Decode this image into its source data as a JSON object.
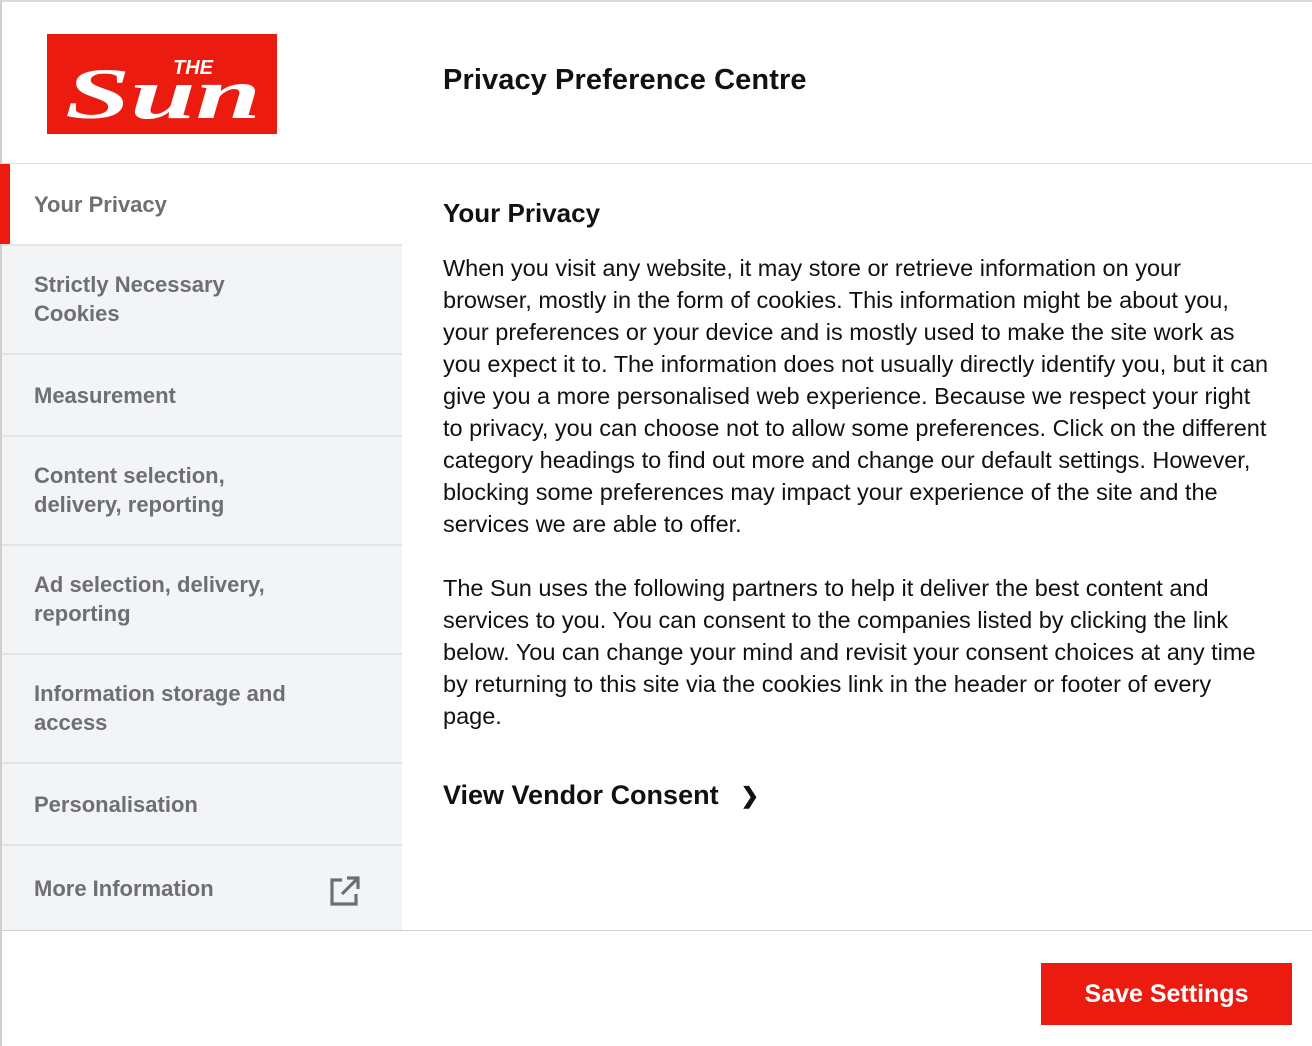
{
  "brand": {
    "logo_alt": "THE Sun",
    "logo_small": "THE",
    "logo_large": "Sun",
    "brand_color": "#eb1c0f"
  },
  "modal": {
    "title": "Privacy Preference Centre"
  },
  "sidebar": {
    "items": [
      {
        "label": "Your Privacy",
        "active": true
      },
      {
        "label": "Strictly Necessary Cookies",
        "active": false
      },
      {
        "label": "Measurement",
        "active": false
      },
      {
        "label": "Content selection, delivery, reporting",
        "active": false
      },
      {
        "label": "Ad selection, delivery, reporting",
        "active": false
      },
      {
        "label": "Information storage and access",
        "active": false
      },
      {
        "label": "Personalisation",
        "active": false
      },
      {
        "label": "More Information",
        "active": false,
        "icon": "external-link-icon"
      }
    ]
  },
  "content": {
    "heading": "Your Privacy",
    "paragraphs": [
      "When you visit any website, it may store or retrieve information on your browser, mostly in the form of cookies. This information might be about you, your preferences or your device and is mostly used to make the site work as you expect it to. The information does not usually directly identify you, but it can give you a more personalised web experience. Because we respect your right to privacy, you can choose not to allow some preferences. Click on the different category headings to find out more and change our default settings. However, blocking some preferences may impact your experience of the site and the services we are able to offer.",
      "The Sun uses the following partners to help it deliver the best content and services to you. You can consent to the companies listed by clicking the link below. You can change your mind and revisit your consent choices at any time by returning to this site via the cookies link in the header or footer of every page."
    ],
    "vendor_link": "View Vendor Consent",
    "vendor_link_icon": "chevron-right-icon"
  },
  "footer": {
    "save_label": "Save Settings"
  }
}
